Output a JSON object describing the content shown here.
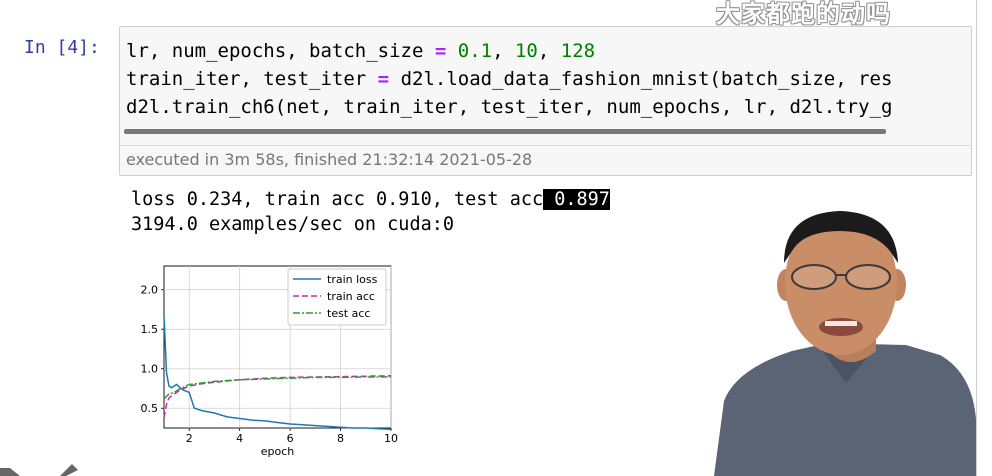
{
  "watermark": "大家都跑的动吗",
  "cell": {
    "prompt": "In [4]:",
    "code": {
      "l1_vars": "lr, num_epochs, batch_size ",
      "l1_eq": "=",
      "l1_sp": " ",
      "l1_v1": "0.1",
      "l1_c1": ", ",
      "l1_v2": "10",
      "l1_c2": ", ",
      "l1_v3": "128",
      "l2_vars": "train_iter, test_iter ",
      "l2_eq": "=",
      "l2_rest": " d2l.load_data_fashion_mnist(batch_size, res",
      "l3": "d2l.train_ch6(net, train_iter, test_iter, num_epochs, lr, d2l.try_g"
    },
    "exec_info": "executed in 3m 58s, finished 21:32:14 2021-05-28"
  },
  "output": {
    "line1_main": "loss 0.234, train acc 0.910, test acc",
    "line1_highlight": " 0.897",
    "line2": "3194.0 examples/sec on cuda:0"
  },
  "chart_data": {
    "type": "line",
    "xlabel": "epoch",
    "ylabel": "",
    "xlim": [
      1,
      10
    ],
    "ylim": [
      0.25,
      2.3
    ],
    "xticks": [
      "2",
      "4",
      "6",
      "8",
      "10"
    ],
    "yticks": [
      "0.5",
      "1.0",
      "1.5",
      "2.0"
    ],
    "grid": true,
    "legend_position": "top-right",
    "series": [
      {
        "name": "train loss",
        "color": "#1f77b4",
        "dash": "solid",
        "x": [
          1.0,
          1.1,
          1.2,
          1.3,
          1.5,
          1.7,
          2.0,
          2.2,
          2.5,
          3.0,
          3.5,
          4.0,
          4.5,
          5.0,
          5.5,
          6.0,
          6.5,
          7.0,
          7.5,
          8.0,
          8.5,
          9.0,
          9.5,
          10.0
        ],
        "y": [
          1.68,
          0.95,
          0.78,
          0.76,
          0.8,
          0.74,
          0.7,
          0.5,
          0.47,
          0.44,
          0.39,
          0.37,
          0.35,
          0.34,
          0.32,
          0.3,
          0.29,
          0.28,
          0.27,
          0.26,
          0.25,
          0.25,
          0.24,
          0.234
        ]
      },
      {
        "name": "train acc",
        "color": "#c02cae",
        "dash": "6,3",
        "x": [
          1.0,
          1.1,
          1.2,
          1.3,
          1.5,
          1.7,
          2.0,
          2.5,
          3.0,
          4.0,
          5.0,
          6.0,
          7.0,
          8.0,
          9.0,
          10.0
        ],
        "y": [
          0.38,
          0.55,
          0.63,
          0.66,
          0.7,
          0.74,
          0.78,
          0.81,
          0.83,
          0.86,
          0.88,
          0.89,
          0.895,
          0.9,
          0.905,
          0.91
        ]
      },
      {
        "name": "test acc",
        "color": "#2ca02c",
        "dash": "7,2,2,2",
        "x": [
          1.0,
          1.2,
          1.4,
          1.6,
          2.0,
          2.5,
          3.0,
          4.0,
          5.0,
          6.0,
          7.0,
          8.0,
          9.0,
          10.0
        ],
        "y": [
          0.62,
          0.68,
          0.7,
          0.74,
          0.8,
          0.82,
          0.84,
          0.86,
          0.87,
          0.88,
          0.89,
          0.89,
          0.895,
          0.897
        ]
      }
    ]
  }
}
